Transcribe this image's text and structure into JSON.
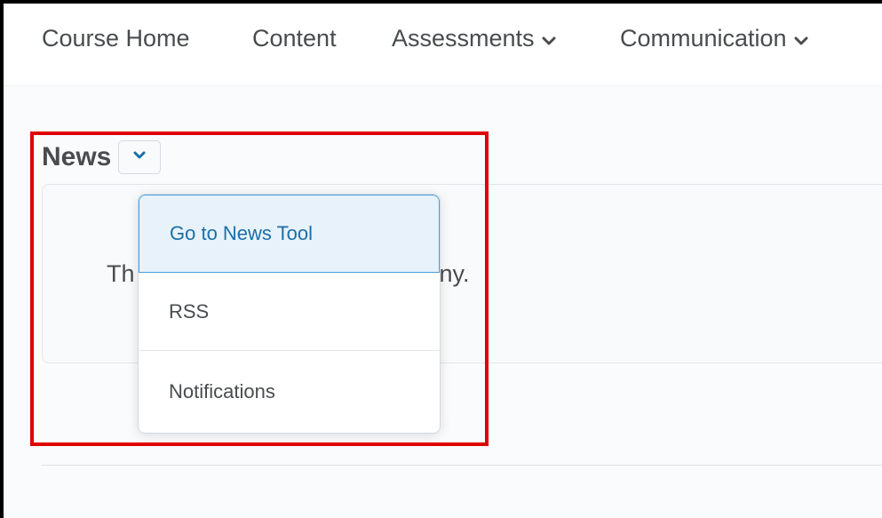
{
  "nav": {
    "items": [
      {
        "label": "Course Home"
      },
      {
        "label": "Content"
      },
      {
        "label": "Assessments"
      },
      {
        "label": "Communication"
      }
    ]
  },
  "widget": {
    "title": "News",
    "message_visible_start": "Th",
    "message_visible_end": "ny."
  },
  "dropdown": {
    "items": [
      {
        "label": "Go to News Tool"
      },
      {
        "label": "RSS"
      },
      {
        "label": "Notifications"
      }
    ]
  },
  "colors": {
    "highlight": "#e00000",
    "menu_active_bg": "#e8f2fa",
    "menu_active_border": "#4a9fdb",
    "chevron": "#1a6fa8"
  }
}
